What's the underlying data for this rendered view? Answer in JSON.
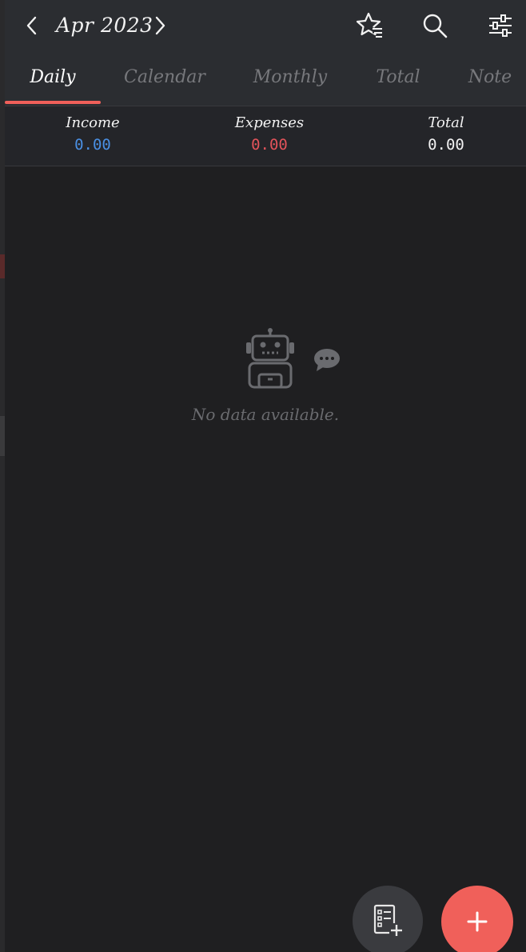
{
  "header": {
    "month_label": "Apr 2023",
    "prev_icon": "chevron-left-icon",
    "next_icon": "chevron-right-icon",
    "actions": [
      "star-list-icon",
      "search-icon",
      "sliders-icon"
    ]
  },
  "tabs": {
    "daily": "Daily",
    "calendar": "Calendar",
    "monthly": "Monthly",
    "total": "Total",
    "note": "Note",
    "active": "Daily"
  },
  "summary": {
    "income_label": "Income",
    "income_value": "0.00",
    "expenses_label": "Expenses",
    "expenses_value": "0.00",
    "total_label": "Total",
    "total_value": "0.00"
  },
  "empty_state": {
    "icon": "robot-icon",
    "message": "No data available."
  },
  "fabs": {
    "template_icon": "checklist-add-icon",
    "add_icon": "plus-icon"
  },
  "colors": {
    "accent": "#f0605a",
    "income": "#4a8fe2",
    "expenses": "#e2535a",
    "background": "#1f1f21",
    "header": "#2b2d31"
  }
}
